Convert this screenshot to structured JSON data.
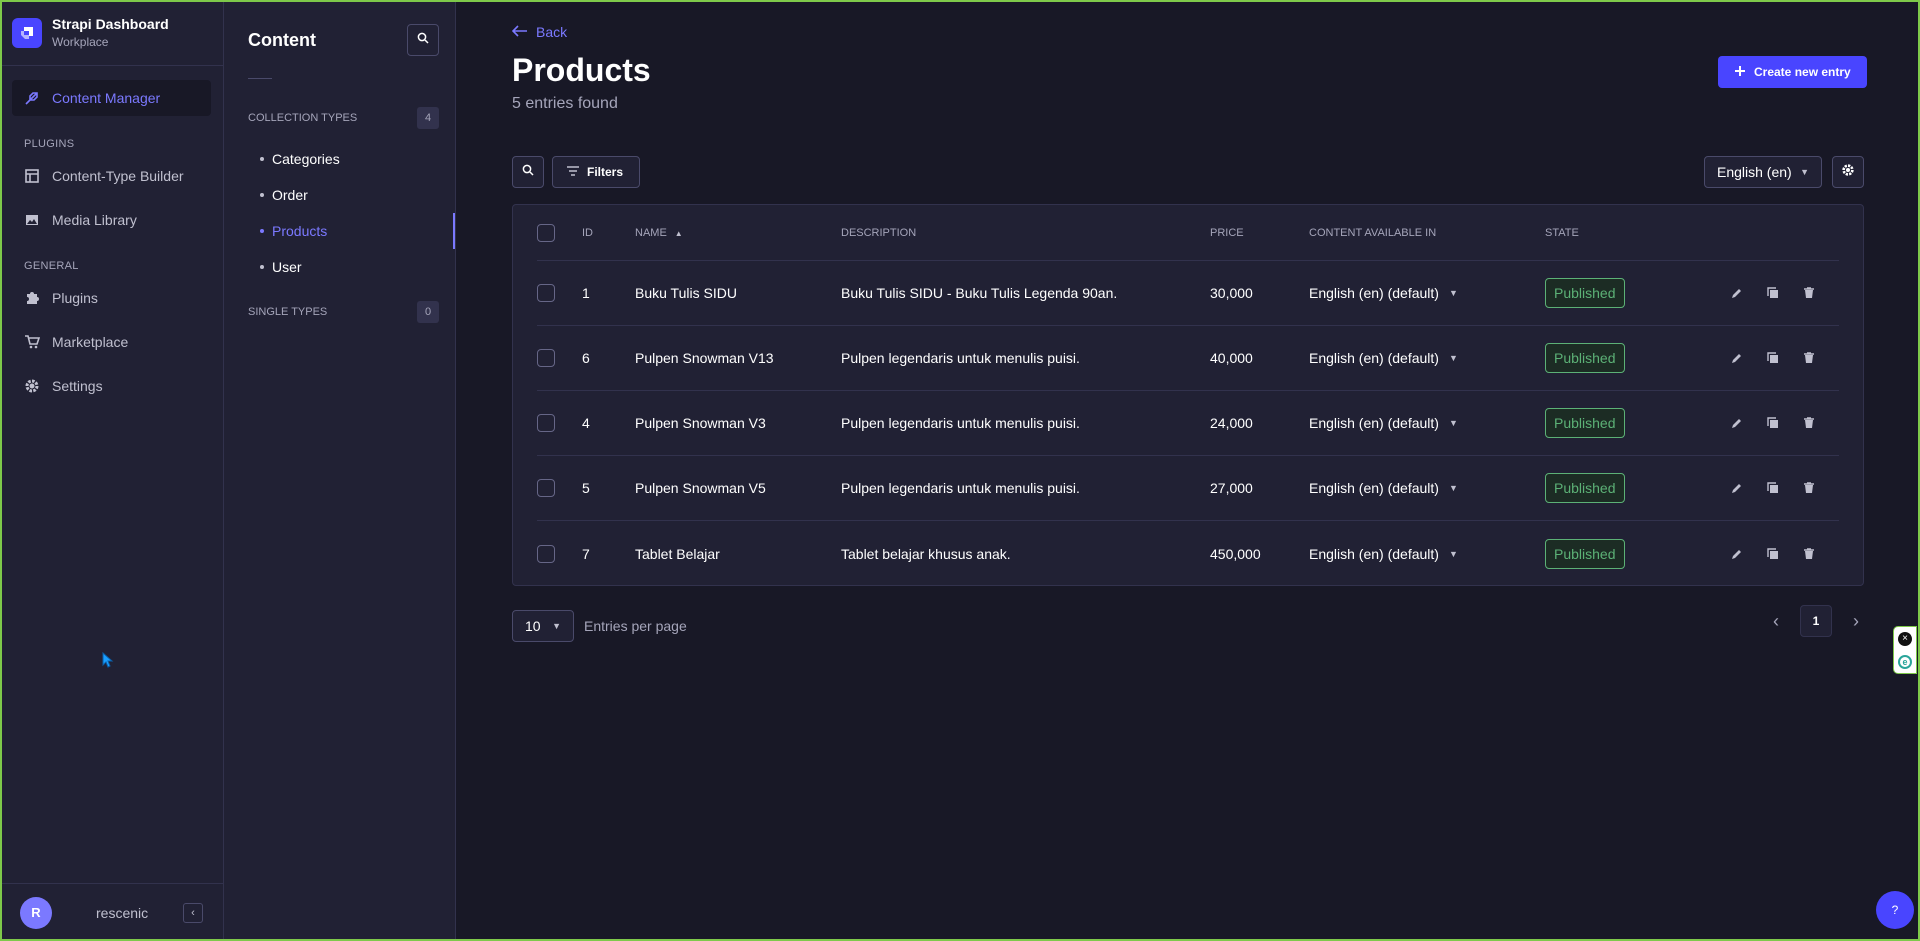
{
  "brand": {
    "title": "Strapi Dashboard",
    "subtitle": "Workplace"
  },
  "mainnav": {
    "active": {
      "label": "Content Manager",
      "icon": "feather-icon"
    },
    "plugins_section": "PLUGINS",
    "plugins": [
      {
        "label": "Content-Type Builder",
        "icon": "layout-icon"
      },
      {
        "label": "Media Library",
        "icon": "image-icon"
      }
    ],
    "general_section": "GENERAL",
    "general": [
      {
        "label": "Plugins",
        "icon": "puzzle-icon"
      },
      {
        "label": "Marketplace",
        "icon": "cart-icon"
      },
      {
        "label": "Settings",
        "icon": "gear-icon"
      }
    ],
    "user": {
      "initial": "R",
      "name": "rescenic"
    },
    "collapse_glyph": "‹"
  },
  "subnav": {
    "title": "Content",
    "collection_label": "COLLECTION TYPES",
    "collection_count": "4",
    "collection_items": [
      "Categories",
      "Order",
      "Products",
      "User"
    ],
    "active_item": "Products",
    "single_label": "SINGLE TYPES",
    "single_count": "0"
  },
  "header": {
    "back_label": "Back",
    "title": "Products",
    "subtitle": "5 entries found",
    "create_label": "Create new entry"
  },
  "toolbar": {
    "filters_label": "Filters",
    "locale": "English (en)"
  },
  "table": {
    "headers": {
      "id": "ID",
      "name": "NAME",
      "description": "DESCRIPTION",
      "price": "PRICE",
      "content_available": "CONTENT AVAILABLE IN",
      "state": "STATE"
    },
    "rows": [
      {
        "id": "1",
        "name": "Buku Tulis SIDU",
        "description": "Buku Tulis SIDU - Buku Tulis Legenda 90an.",
        "price": "30,000",
        "locale": "English (en) (default)",
        "state": "Published"
      },
      {
        "id": "6",
        "name": "Pulpen Snowman V13",
        "description": "Pulpen legendaris untuk menulis puisi.",
        "price": "40,000",
        "locale": "English (en) (default)",
        "state": "Published"
      },
      {
        "id": "4",
        "name": "Pulpen Snowman V3",
        "description": "Pulpen legendaris untuk menulis puisi.",
        "price": "24,000",
        "locale": "English (en) (default)",
        "state": "Published"
      },
      {
        "id": "5",
        "name": "Pulpen Snowman V5",
        "description": "Pulpen legendaris untuk menulis puisi.",
        "price": "27,000",
        "locale": "English (en) (default)",
        "state": "Published"
      },
      {
        "id": "7",
        "name": "Tablet Belajar",
        "description": "Tablet belajar khusus anak.",
        "price": "450,000",
        "locale": "English (en) (default)",
        "state": "Published"
      }
    ]
  },
  "pagination": {
    "per_page": "10",
    "per_page_label": "Entries per page",
    "current_page": "1"
  },
  "help": {
    "label": "?"
  },
  "colors": {
    "accent": "#4945ff",
    "accent_light": "#7b79ff",
    "success": "#5cb176",
    "background": "#181826",
    "surface": "#212134"
  }
}
